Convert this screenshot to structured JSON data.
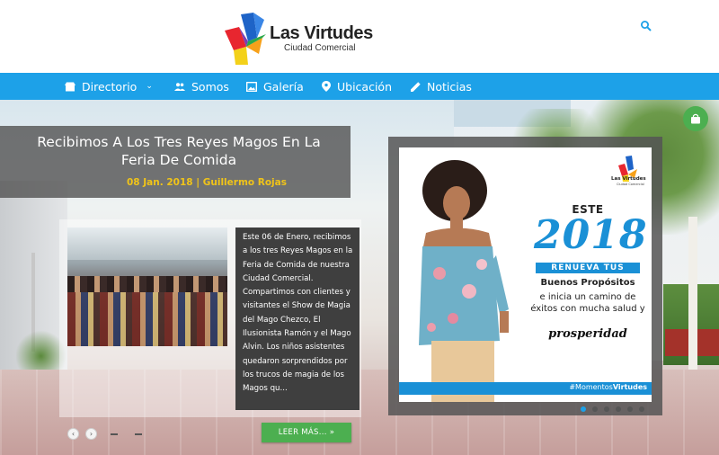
{
  "header": {
    "logo_title": "Las Virtudes",
    "logo_subtitle": "Ciudad Comercial"
  },
  "nav": {
    "items": [
      {
        "label": "Directorio",
        "icon": "store-icon",
        "has_caret": true
      },
      {
        "label": "Somos",
        "icon": "people-icon"
      },
      {
        "label": "Galería",
        "icon": "image-icon"
      },
      {
        "label": "Ubicación",
        "icon": "location-pin-icon"
      },
      {
        "label": "Noticias",
        "icon": "pencil-icon"
      }
    ],
    "caret": "⌄"
  },
  "news": {
    "title": "Recibimos A Los Tres Reyes Magos En La Feria De Comida",
    "meta": "08 Jan. 2018 | Guillermo Rojas",
    "excerpt": "Este 06 de Enero, recibimos a los tres Reyes Magos en la Feria de Comida de nuestra Ciudad Comercial. Compartimos con clientes y visitantes el Show de Magia del Mago Chezco, El Ilusionista Ramón y el Mago Alvin. Los niños asistentes quedaron sorprendidos por los trucos de magia de los Magos qu...",
    "read_more": "LEER MÁS... »",
    "prev": "‹",
    "next": "›"
  },
  "ad": {
    "logo_title": "Las Virtudes",
    "logo_subtitle": "Ciudad Comercial",
    "este": "ESTE",
    "year": "2018",
    "band": "RENUEVA TUS",
    "line1": "Buenos Propósitos",
    "line2": "e inicia un camino de éxitos con mucha salud y",
    "line3": "prosperidad",
    "hashtag_prefix": "#Momentos",
    "hashtag_bold": "Virtudes",
    "dots_total": 6,
    "dots_active_index": 0
  },
  "colors": {
    "nav_blue": "#1da1e8",
    "accent_green": "#4caf50",
    "meta_yellow": "#f0c419",
    "ad_blue": "#1a90d6"
  }
}
